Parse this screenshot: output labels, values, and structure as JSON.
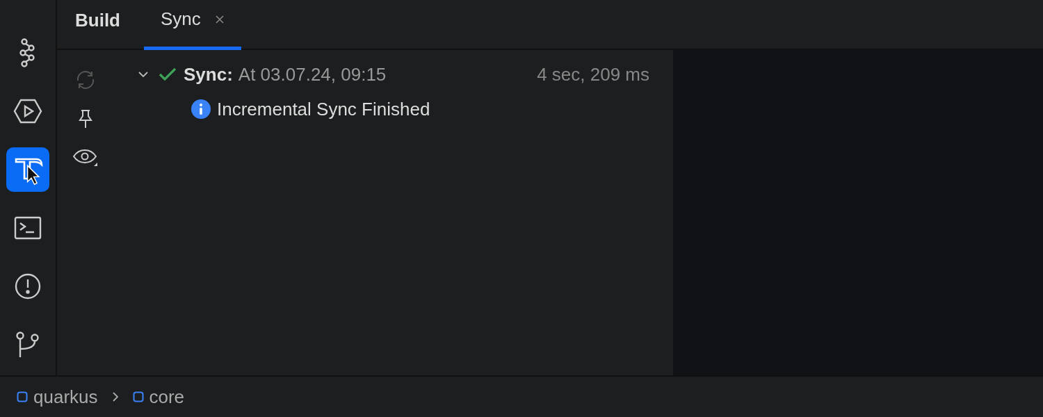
{
  "tool_strip": [
    {
      "kind": "graph",
      "selected": false
    },
    {
      "kind": "run",
      "selected": false
    },
    {
      "kind": "build",
      "selected": true
    },
    {
      "kind": "terminal",
      "selected": false
    },
    {
      "kind": "problems",
      "selected": false
    },
    {
      "kind": "vcs",
      "selected": false
    }
  ],
  "panel_title": "Build",
  "tabs": [
    {
      "label": "Sync",
      "selected": true,
      "closable": true
    }
  ],
  "actions": [
    {
      "kind": "rerun",
      "disabled": true
    },
    {
      "kind": "pin",
      "disabled": false
    },
    {
      "kind": "view",
      "disabled": false
    }
  ],
  "tree": [
    {
      "kind": "success",
      "expanded": true,
      "label": "Sync:",
      "detail": "At 03.07.24, 09:15",
      "duration": "4 sec, 209 ms",
      "children": [
        {
          "kind": "info",
          "label": "Incremental Sync Finished"
        }
      ]
    }
  ],
  "breadcrumbs": [
    "quarkus",
    "core"
  ]
}
